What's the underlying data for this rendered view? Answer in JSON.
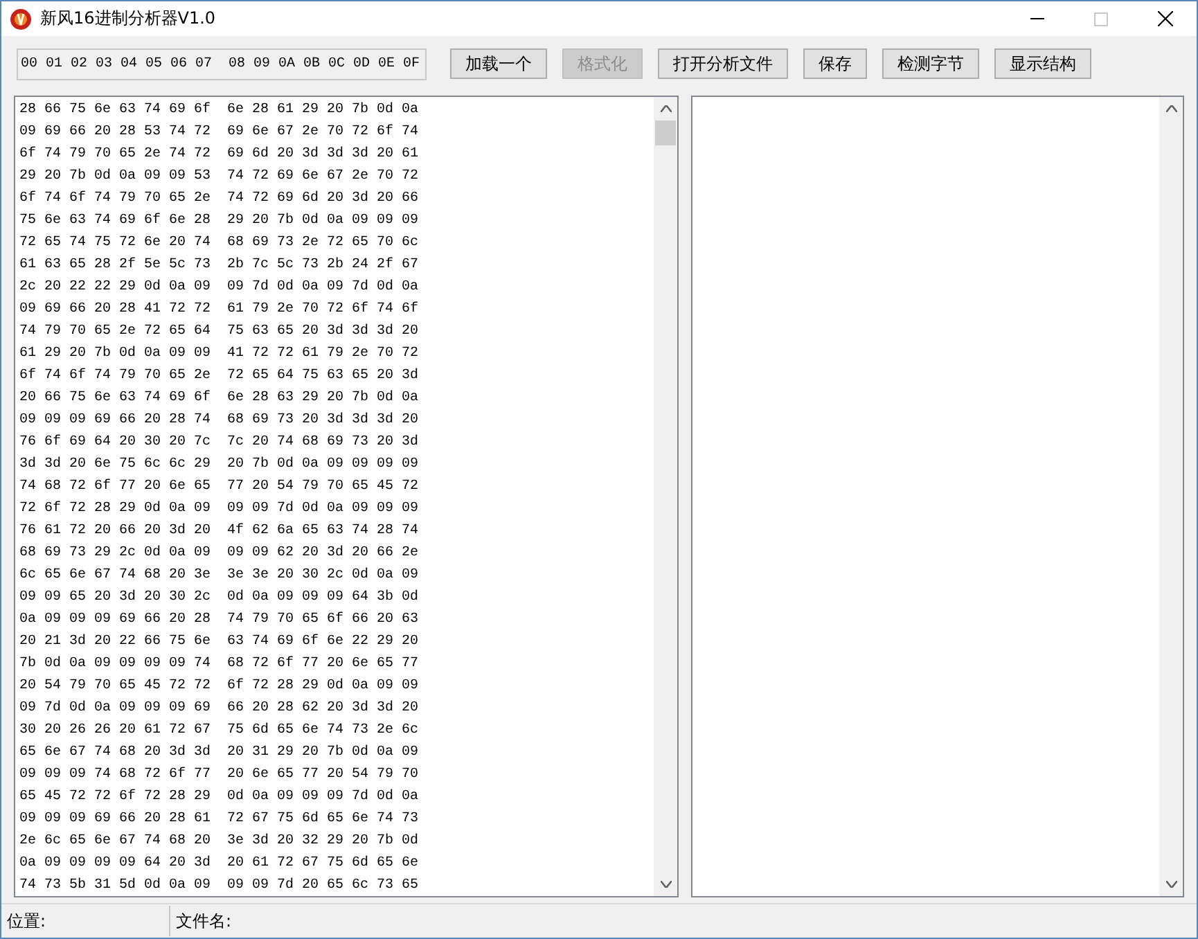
{
  "window": {
    "title": "新风16进制分析器V1.0"
  },
  "toolbar": {
    "column_header": "00 01 02 03 04 05 06 07  08 09 0A 0B 0C 0D 0E 0F",
    "buttons": [
      {
        "label": "加载一个",
        "disabled": false
      },
      {
        "label": "格式化",
        "disabled": true
      },
      {
        "label": "打开分析文件",
        "disabled": false
      },
      {
        "label": "保存",
        "disabled": false
      },
      {
        "label": "检测字节",
        "disabled": false
      },
      {
        "label": "显示结构",
        "disabled": false
      }
    ]
  },
  "hex_view": {
    "lines": [
      "28 66 75 6e 63 74 69 6f  6e 28 61 29 20 7b 0d 0a",
      "09 69 66 20 28 53 74 72  69 6e 67 2e 70 72 6f 74",
      "6f 74 79 70 65 2e 74 72  69 6d 20 3d 3d 3d 20 61",
      "29 20 7b 0d 0a 09 09 53  74 72 69 6e 67 2e 70 72",
      "6f 74 6f 74 79 70 65 2e  74 72 69 6d 20 3d 20 66",
      "75 6e 63 74 69 6f 6e 28  29 20 7b 0d 0a 09 09 09",
      "72 65 74 75 72 6e 20 74  68 69 73 2e 72 65 70 6c",
      "61 63 65 28 2f 5e 5c 73  2b 7c 5c 73 2b 24 2f 67",
      "2c 20 22 22 29 0d 0a 09  09 7d 0d 0a 09 7d 0d 0a",
      "09 69 66 20 28 41 72 72  61 79 2e 70 72 6f 74 6f",
      "74 79 70 65 2e 72 65 64  75 63 65 20 3d 3d 3d 20",
      "61 29 20 7b 0d 0a 09 09  41 72 72 61 79 2e 70 72",
      "6f 74 6f 74 79 70 65 2e  72 65 64 75 63 65 20 3d",
      "20 66 75 6e 63 74 69 6f  6e 28 63 29 20 7b 0d 0a",
      "09 09 09 69 66 20 28 74  68 69 73 20 3d 3d 3d 20",
      "76 6f 69 64 20 30 20 7c  7c 20 74 68 69 73 20 3d",
      "3d 3d 20 6e 75 6c 6c 29  20 7b 0d 0a 09 09 09 09",
      "74 68 72 6f 77 20 6e 65  77 20 54 79 70 65 45 72",
      "72 6f 72 28 29 0d 0a 09  09 09 7d 0d 0a 09 09 09",
      "76 61 72 20 66 20 3d 20  4f 62 6a 65 63 74 28 74",
      "68 69 73 29 2c 0d 0a 09  09 09 62 20 3d 20 66 2e",
      "6c 65 6e 67 74 68 20 3e  3e 3e 20 30 2c 0d 0a 09",
      "09 09 65 20 3d 20 30 2c  0d 0a 09 09 09 64 3b 0d",
      "0a 09 09 09 69 66 20 28  74 79 70 65 6f 66 20 63",
      "20 21 3d 20 22 66 75 6e  63 74 69 6f 6e 22 29 20",
      "7b 0d 0a 09 09 09 09 74  68 72 6f 77 20 6e 65 77",
      "20 54 79 70 65 45 72 72  6f 72 28 29 0d 0a 09 09",
      "09 7d 0d 0a 09 09 09 69  66 20 28 62 20 3d 3d 20",
      "30 20 26 26 20 61 72 67  75 6d 65 6e 74 73 2e 6c",
      "65 6e 67 74 68 20 3d 3d  20 31 29 20 7b 0d 0a 09",
      "09 09 09 74 68 72 6f 77  20 6e 65 77 20 54 79 70",
      "65 45 72 72 6f 72 28 29  0d 0a 09 09 09 7d 0d 0a",
      "09 09 09 69 66 20 28 61  72 67 75 6d 65 6e 74 73",
      "2e 6c 65 6e 67 74 68 20  3e 3d 20 32 29 20 7b 0d",
      "0a 09 09 09 09 64 20 3d  20 61 72 67 75 6d 65 6e",
      "74 73 5b 31 5d 0d 0a 09  09 09 7d 20 65 6c 73 65"
    ]
  },
  "status_bar": {
    "position_label": "位置:",
    "filename_label": "文件名:"
  }
}
